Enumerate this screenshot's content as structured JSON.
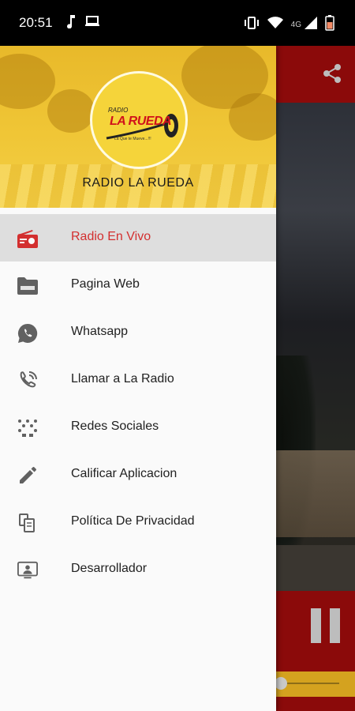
{
  "status_bar": {
    "time": "20:51",
    "left_icons": [
      "music-note-icon",
      "laptop-icon"
    ],
    "right_icons": [
      "vibrate-icon",
      "wifi-icon",
      "signal-icon",
      "battery-icon"
    ],
    "network_label": "4G"
  },
  "drawer": {
    "header": {
      "logo_top": "RADIO",
      "logo_name": "LA RUEDA",
      "logo_sub": "La Que te Mueve...!!!",
      "title": "RADIO LA RUEDA"
    },
    "items": [
      {
        "label": "Radio En Vivo",
        "icon": "radio-icon",
        "active": true
      },
      {
        "label": "Pagina Web",
        "icon": "web-folder-icon",
        "active": false
      },
      {
        "label": "Whatsapp",
        "icon": "whatsapp-icon",
        "active": false
      },
      {
        "label": "Llamar a La Radio",
        "icon": "phone-call-icon",
        "active": false
      },
      {
        "label": "Redes Sociales",
        "icon": "social-network-icon",
        "active": false
      },
      {
        "label": "Calificar Aplicacion",
        "icon": "pencil-icon",
        "active": false
      },
      {
        "label": "Política De Privacidad",
        "icon": "copy-document-icon",
        "active": false
      },
      {
        "label": "Desarrollador",
        "icon": "developer-screen-icon",
        "active": false
      }
    ]
  },
  "background_app": {
    "toolbar_icon": "share-icon",
    "player_icon": "pause-icon"
  },
  "colors": {
    "accent_red": "#d32f2f",
    "toolbar_red": "#8b0a0a",
    "header_yellow": "#f0c636",
    "icon_gray": "#616161"
  }
}
